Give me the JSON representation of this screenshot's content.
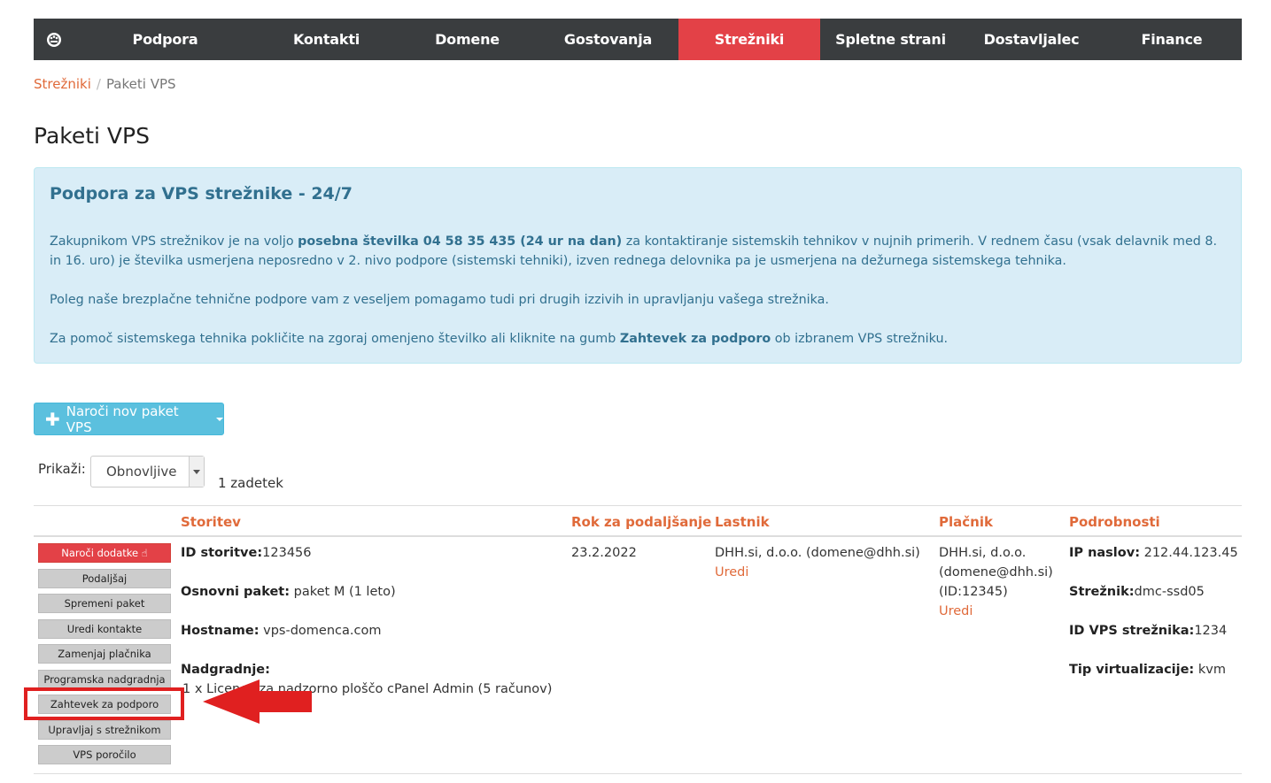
{
  "nav": {
    "items": [
      "Podpora",
      "Kontakti",
      "Domene",
      "Gostovanja",
      "Strežniki",
      "Spletne strani",
      "Dostavljalec",
      "Finance"
    ],
    "active_index": 4
  },
  "breadcrumb": {
    "parent": "Strežniki",
    "separator": "/",
    "current": "Paketi VPS"
  },
  "page_title": "Paketi VPS",
  "alert": {
    "title": "Podpora za VPS strežnike - 24/7",
    "p1_a": "Zakupnikom VPS strežnikov je na voljo ",
    "p1_b": "posebna številka 04 58 35 435 (24 ur na dan)",
    "p1_c": " za kontaktiranje sistemskih tehnikov v nujnih primerih. V rednem času (vsak delavnik med 8. in 16. uro) je številka usmerjena neposredno v 2. nivo podpore (sistemski tehniki), izven rednega delovnika pa je usmerjena na dežurnega sistemskega tehnika.",
    "p2": "Poleg naše brezplačne tehnične podpore vam z veseljem pomagamo tudi pri drugih izzivih in upravljanju vašega strežnika.",
    "p3_a": "Za pomoč sistemskega tehnika pokličite na zgoraj omenjeno številko ali kliknite na gumb ",
    "p3_b": "Zahtevek za podporo",
    "p3_c": " ob izbranem VPS strežniku."
  },
  "order_button": {
    "label": "Naroči nov paket VPS"
  },
  "filter": {
    "label": "Prikaži:",
    "selected": "Obnovljive",
    "count": "1 zadetek"
  },
  "table": {
    "headers": [
      "Storitev",
      "Rok za podaljšanje",
      "Lastnik",
      "Plačnik",
      "Podrobnosti"
    ],
    "row": {
      "actions": [
        "Naroči dodatke",
        "Podaljšaj",
        "Spremeni paket",
        "Uredi kontakte",
        "Zamenjaj plačnika",
        "Programska nadgradnja",
        "Zahtevek za podporo",
        "Upravljaj s strežnikom",
        "VPS poročilo"
      ],
      "service": {
        "id_label": "ID storitve:",
        "id_value": "123456",
        "package_label": "Osnovni paket:",
        "package_value": " paket M (1 leto)",
        "hostname_label": "Hostname:",
        "hostname_value": " vps-domenca.com",
        "upgrades_label": "Nadgradnje:",
        "upgrades_value": "1 x Licenca za nadzorno ploščo cPanel Admin (5 računov)"
      },
      "renewal": "23.2.2022",
      "owner": {
        "name": "DHH.si, d.o.o. (domene@dhh.si)",
        "edit": "Uredi"
      },
      "payer": {
        "line1": "DHH.si, d.o.o.",
        "line2": "(domene@dhh.si)",
        "line3": "(ID:12345)",
        "edit": "Uredi"
      },
      "details": {
        "ip_label": "IP naslov:",
        "ip_value": " 212.44.123.45",
        "server_label": "Strežnik:",
        "server_value": "dmc-ssd05",
        "vpsid_label": "ID VPS strežnika:",
        "vpsid_value": "1234",
        "virt_label": "Tip virtualizacije:",
        "virt_value": " kvm"
      }
    }
  },
  "colors": {
    "nav_bg": "#3a3d3f",
    "nav_active": "#e34147",
    "accent": "#e06a3a",
    "alert_bg": "#d9edf7",
    "alert_text": "#31708f",
    "info_button": "#5bc0de",
    "highlight": "#e02020"
  }
}
